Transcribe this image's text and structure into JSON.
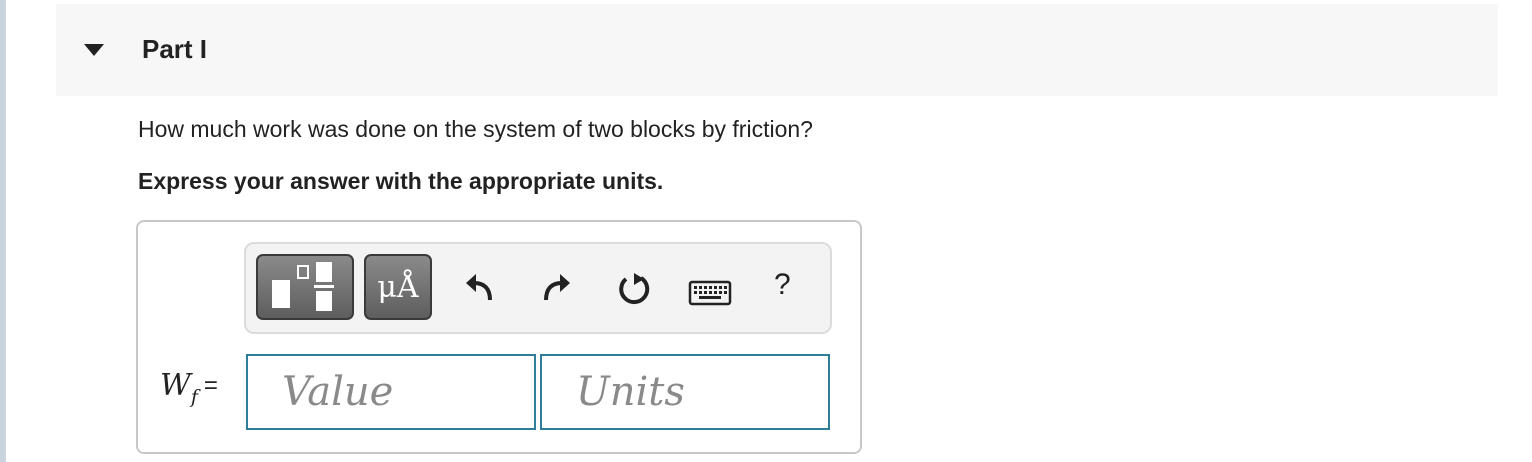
{
  "part": {
    "title": "Part I",
    "question": "How much work was done on the system of two blocks by friction?",
    "instruction": "Express your answer with the appropriate units."
  },
  "toolbar": {
    "buttons": [
      {
        "icon": "templates-icon"
      },
      {
        "icon": "units-icon",
        "label": "μÅ"
      },
      {
        "icon": "undo-icon"
      },
      {
        "icon": "redo-icon"
      },
      {
        "icon": "reset-icon"
      },
      {
        "icon": "keyboard-icon"
      },
      {
        "icon": "help-icon",
        "label": "?"
      }
    ]
  },
  "answer": {
    "variable": "W",
    "subscript": "f",
    "equals": "=",
    "value_placeholder": "Value",
    "units_placeholder": "Units",
    "value": "",
    "units": ""
  },
  "colors": {
    "header_bg": "#f7f7f7",
    "input_border": "#2e7d9a",
    "left_rule": "#c9d3e0"
  }
}
